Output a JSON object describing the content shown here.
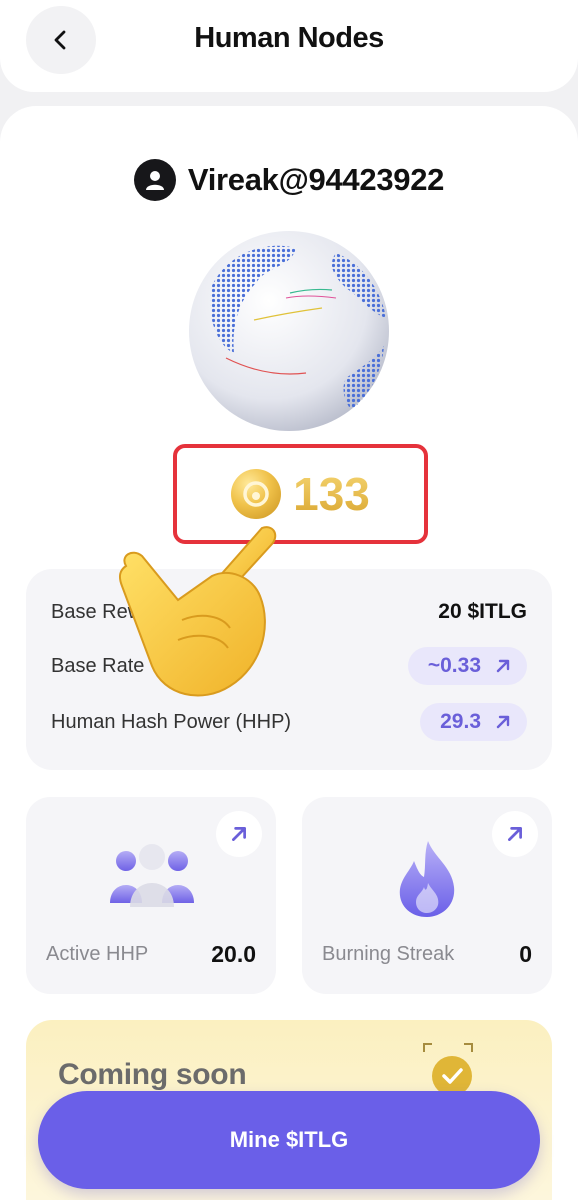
{
  "header": {
    "title": "Human Nodes",
    "back_icon": "chevron-left-icon"
  },
  "user": {
    "name": "Vireak@94423922",
    "avatar_icon": "user-avatar-icon"
  },
  "balance": {
    "value": "133",
    "coin_icon": "itlg-coin-icon"
  },
  "stats": {
    "rows": [
      {
        "label": "Base Rewa",
        "value": "20 $ITLG"
      },
      {
        "label": "Base Rate",
        "value": "~0.33"
      },
      {
        "label": "Human Hash Power (HHP)",
        "value": "29.3"
      }
    ]
  },
  "tiles": [
    {
      "label": "Active HHP",
      "value": "20.0",
      "icon": "people-icon"
    },
    {
      "label": "Burning Streak",
      "value": "0",
      "icon": "flame-icon"
    }
  ],
  "coming_soon": {
    "title": "Coming soon"
  },
  "mine_button": {
    "label": "Mine $ITLG"
  },
  "colors": {
    "accent": "#6a5fe8",
    "highlight_border": "#e5323b",
    "coin_gold": "#e8b93c",
    "pill_bg": "#e9e7fb"
  }
}
